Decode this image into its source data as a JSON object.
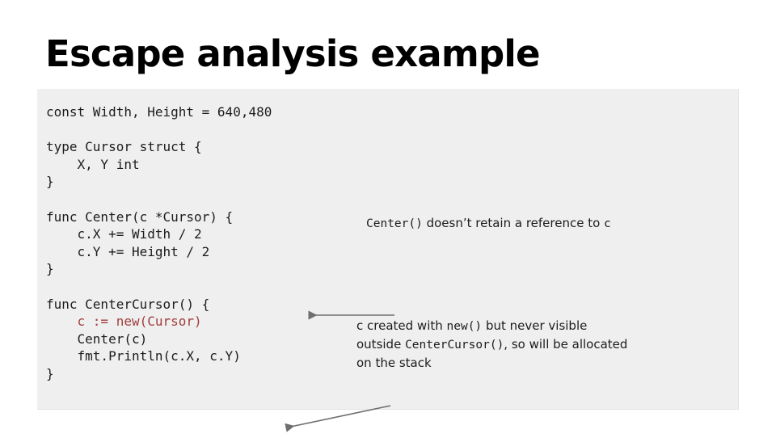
{
  "slide": {
    "title": "Escape analysis example",
    "background_color": "#ffffff"
  },
  "code_block": {
    "background_color": "#efefef",
    "highlight_color": "#a13c3c",
    "text_color": "#1c1c1c",
    "lines": [
      "const Width, Height = 640,480",
      "",
      "type Cursor struct {",
      "    X, Y int",
      "}",
      "",
      "func Center(c *Cursor) {",
      "    c.X += Width / 2",
      "    c.Y += Height / 2",
      "}",
      "",
      "func CenterCursor() {",
      "    c := new(Cursor)",
      "    Center(c)",
      "    fmt.Println(c.X, c.Y)",
      "}"
    ],
    "highlighted_line_index": 12,
    "highlighted_line_text": "    c := new(Cursor)"
  },
  "annotations": [
    {
      "id": "annotation-one",
      "segments": [
        {
          "text": "Center()",
          "style": "mono"
        },
        {
          "text": "  doesn’t retain a reference to  ",
          "style": "sans"
        },
        {
          "text": "c",
          "style": "mono"
        }
      ],
      "plain_text": "Center()  doesn’t retain a reference to  c"
    },
    {
      "id": "annotation-two",
      "segments": [
        {
          "text": "c created with ",
          "style": "sans"
        },
        {
          "text": "new()",
          "style": "mono"
        },
        {
          "text": " but never visible outside ",
          "style": "sans"
        },
        {
          "text": "CenterCursor()",
          "style": "mono"
        },
        {
          "text": ", so will be allocated on the stack",
          "style": "sans"
        }
      ],
      "plain_text": "c created with new() but never visible outside CenterCursor(), so will be allocated on the stack"
    }
  ],
  "arrows": [
    {
      "id": "arrow-center",
      "color": "#6e6e6e",
      "points_to": "func Center(c *Cursor) {",
      "direction": "left"
    },
    {
      "id": "arrow-new",
      "color": "#6e6e6e",
      "points_to": "c := new(Cursor)",
      "direction": "down-left"
    }
  ]
}
